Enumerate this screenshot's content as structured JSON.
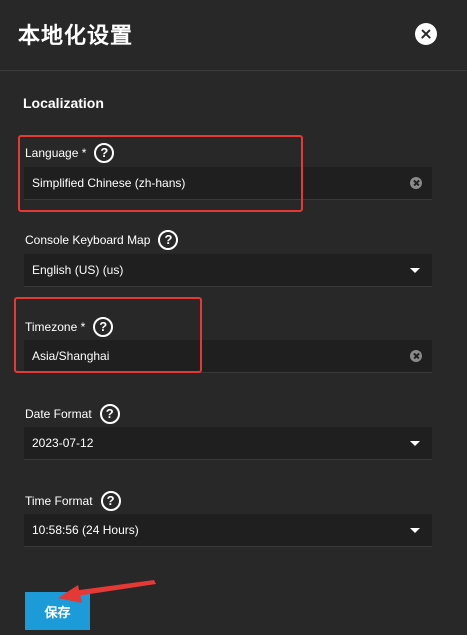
{
  "dialog": {
    "title": "本地化设置",
    "close_icon": "close-circle-icon"
  },
  "section": {
    "title": "Localization"
  },
  "fields": {
    "language": {
      "label": "Language *",
      "value": "Simplified Chinese (zh-hans)",
      "control": "clearable-select",
      "highlighted": true
    },
    "keyboard_map": {
      "label": "Console Keyboard Map",
      "value": "English (US) (us)",
      "control": "select"
    },
    "timezone": {
      "label": "Timezone *",
      "value": "Asia/Shanghai",
      "control": "clearable-select",
      "highlighted": true
    },
    "date_format": {
      "label": "Date Format",
      "value": "2023-07-12",
      "control": "select"
    },
    "time_format": {
      "label": "Time Format",
      "value": "10:58:56 (24 Hours)",
      "control": "select"
    }
  },
  "help_icon_glyph": "?",
  "save_button": {
    "label": "保存"
  },
  "colors": {
    "background": "#282828",
    "field_background": "#1f1f1f",
    "accent": "#1c9bd8",
    "highlight": "#e53935",
    "text": "#ffffff"
  }
}
